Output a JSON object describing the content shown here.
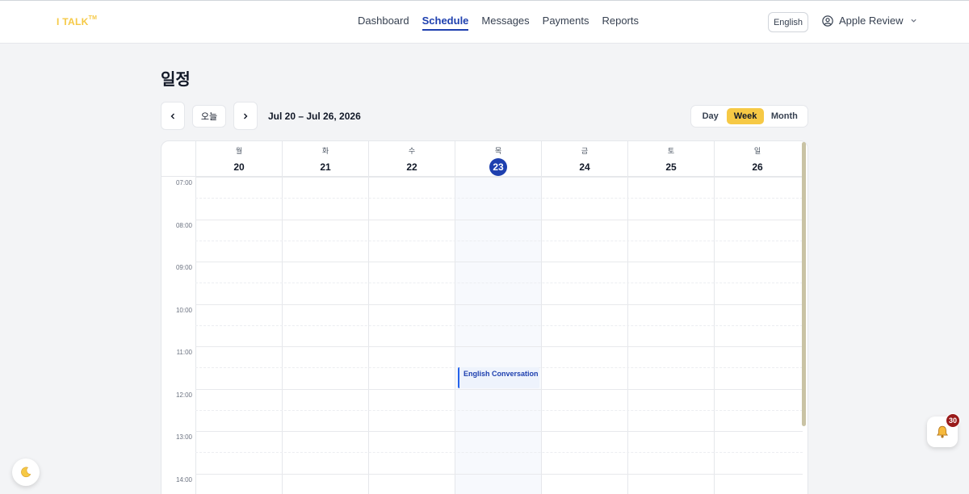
{
  "app": {
    "logo": "I TALK",
    "logo_tm": "TM"
  },
  "nav": {
    "items": [
      {
        "label": "Dashboard",
        "active": false
      },
      {
        "label": "Schedule",
        "active": true
      },
      {
        "label": "Messages",
        "active": false
      },
      {
        "label": "Payments",
        "active": false
      },
      {
        "label": "Reports",
        "active": false
      }
    ]
  },
  "header": {
    "language": "English",
    "user_name": "Apple Review"
  },
  "page": {
    "title": "일정"
  },
  "toolbar": {
    "prev_icon": "chevron-left-icon",
    "next_icon": "chevron-right-icon",
    "today_label": "오늘",
    "date_range": "Jul 20 – Jul 26, 2026",
    "views": [
      {
        "label": "Day",
        "active": false
      },
      {
        "label": "Week",
        "active": true
      },
      {
        "label": "Month",
        "active": false
      }
    ]
  },
  "calendar": {
    "days": [
      {
        "dow": "월",
        "date": "20",
        "today": false
      },
      {
        "dow": "화",
        "date": "21",
        "today": false
      },
      {
        "dow": "수",
        "date": "22",
        "today": false
      },
      {
        "dow": "목",
        "date": "23",
        "today": true
      },
      {
        "dow": "금",
        "date": "24",
        "today": false
      },
      {
        "dow": "토",
        "date": "25",
        "today": false
      },
      {
        "dow": "일",
        "date": "26",
        "today": false
      }
    ],
    "times": [
      "07:00",
      "08:00",
      "09:00",
      "10:00",
      "11:00",
      "12:00",
      "13:00",
      "14:00"
    ],
    "events": [
      {
        "title": "English Conversation",
        "day": "23",
        "start": "11:30",
        "end": "12:00"
      }
    ]
  },
  "notifications": {
    "count": "30",
    "icon": "bell-icon"
  },
  "theme_toggle": {
    "icon": "moon-icon"
  },
  "colors": {
    "accent": "#f6c945",
    "primary": "#1e40af",
    "badge": "#991b1b"
  }
}
